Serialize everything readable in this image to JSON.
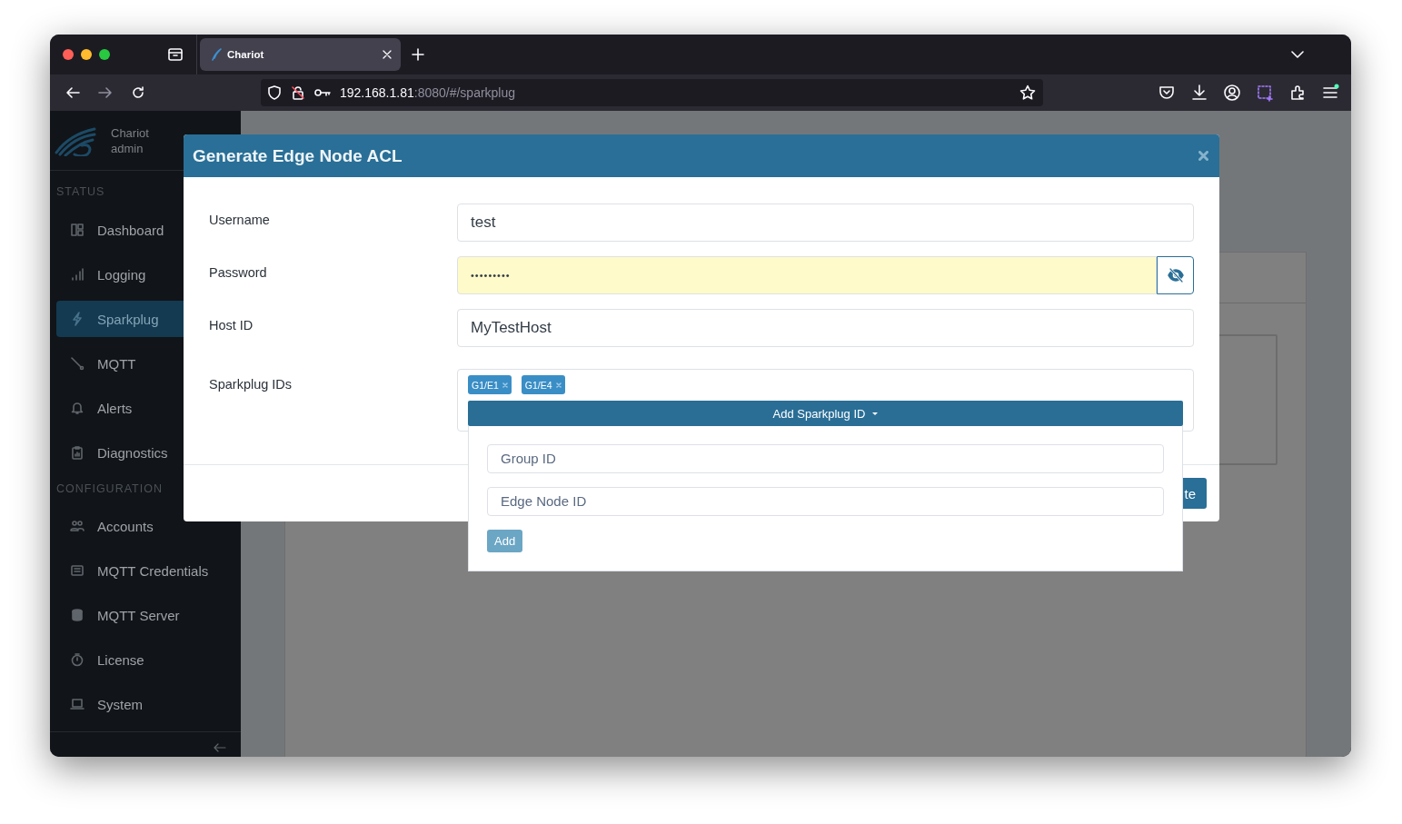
{
  "browser": {
    "tab": {
      "title": "Chariot",
      "selected": true
    },
    "url_host": "192.168.1.81",
    "url_path": ":8080/#/sparkplug",
    "forward_disabled": true
  },
  "sidebar": {
    "app_name": "Chariot",
    "user": "admin",
    "sections": [
      {
        "heading": "STATUS",
        "items": [
          {
            "label": "Dashboard",
            "selected": false
          },
          {
            "label": "Logging",
            "selected": false
          },
          {
            "label": "Sparkplug",
            "selected": true
          },
          {
            "label": "MQTT",
            "selected": false
          },
          {
            "label": "Alerts",
            "selected": false
          },
          {
            "label": "Diagnostics",
            "selected": false
          }
        ]
      },
      {
        "heading": "CONFIGURATION",
        "items": [
          {
            "label": "Accounts",
            "selected": false
          },
          {
            "label": "MQTT Credentials",
            "selected": false
          },
          {
            "label": "MQTT Server",
            "selected": false
          },
          {
            "label": "License",
            "selected": false
          },
          {
            "label": "System",
            "selected": false
          }
        ]
      }
    ]
  },
  "modal": {
    "title": "Generate Edge Node ACL",
    "fields": [
      {
        "kind": "text",
        "label": "Username",
        "value": "test"
      },
      {
        "kind": "password",
        "label": "Password",
        "value": "•••••••••",
        "autofilled": true
      },
      {
        "kind": "text",
        "label": "Host ID",
        "value": "MyTestHost"
      },
      {
        "kind": "tags",
        "label": "Sparkplug IDs",
        "tags": [
          "G1/E1",
          "G1/E4"
        ],
        "dropdown": "Add Sparkplug ID",
        "expanded": true
      }
    ],
    "submit": "te"
  },
  "dropdown": {
    "fields": [
      {
        "placeholder": "Group ID"
      },
      {
        "placeholder": "Edge Node ID"
      }
    ],
    "button": "Add"
  }
}
